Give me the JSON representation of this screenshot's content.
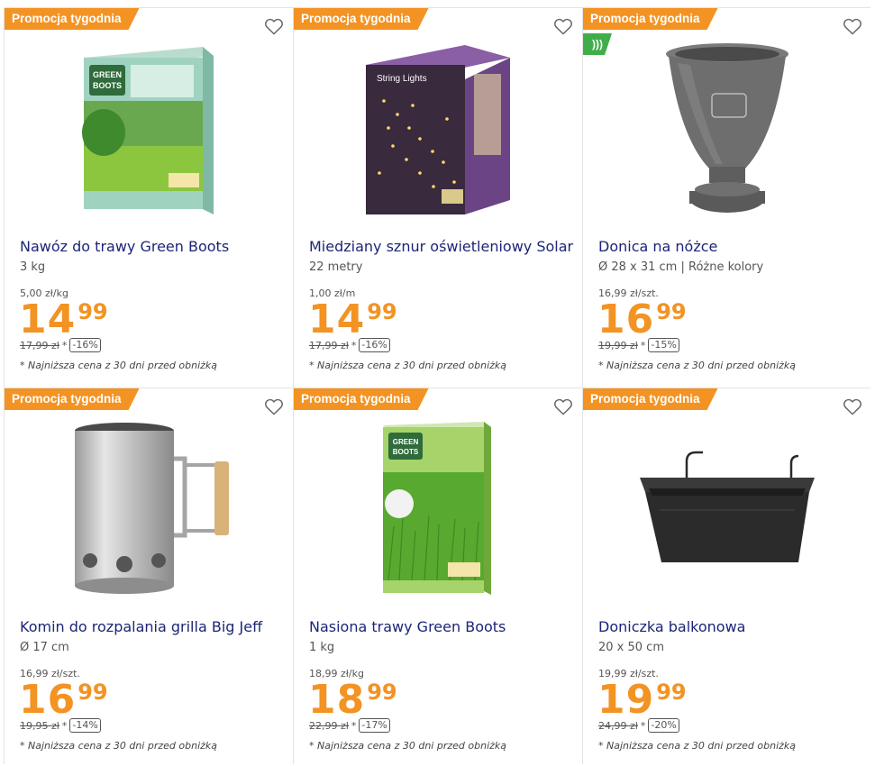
{
  "colors": {
    "badge": "#f39323",
    "price": "#f39323",
    "title": "#1c2578",
    "eco": "#3fae49"
  },
  "products": [
    {
      "badge": "Promocja tygodnia",
      "name": "Nawóz do trawy Green Boots",
      "variant": "3 kg",
      "unit_price": "5,00 zł/kg",
      "price_int": "14",
      "price_dec": "99",
      "old_price": "17,99 zł",
      "old_star": "*",
      "discount": "-16%",
      "note": "* Najniższa cena z 30 dni przed obniżką",
      "image_icon": "green-boots-fertilizer-box"
    },
    {
      "badge": "Promocja tygodnia",
      "name": "Miedziany sznur oświetleniowy Solar",
      "variant": "22 metry",
      "unit_price": "1,00 zł/m",
      "price_int": "14",
      "price_dec": "99",
      "old_price": "17,99 zł",
      "old_star": "*",
      "discount": "-16%",
      "note": "* Najniższa cena z 30 dni przed obniżką",
      "image_icon": "solar-string-lights-box"
    },
    {
      "badge": "Promocja tygodnia",
      "eco_icon": "eco-leaf-icon",
      "name": "Donica na nóżce",
      "variant": "Ø 28 x 31 cm | Różne kolory",
      "unit_price": "16,99 zł/szt.",
      "price_int": "16",
      "price_dec": "99",
      "old_price": "19,99 zł",
      "old_star": "*",
      "discount": "-15%",
      "note": "* Najniższa cena z 30 dni przed obniżką",
      "image_icon": "footed-planter"
    },
    {
      "badge": "Promocja tygodnia",
      "name": "Komin do rozpalania grilla Big Jeff",
      "variant": "Ø 17 cm",
      "unit_price": "16,99 zł/szt.",
      "price_int": "16",
      "price_dec": "99",
      "old_price": "19,95 zł",
      "old_star": "*",
      "discount": "-14%",
      "note": "* Najniższa cena z 30 dni przed obniżką",
      "image_icon": "chimney-starter"
    },
    {
      "badge": "Promocja tygodnia",
      "name": "Nasiona trawy Green Boots",
      "variant": "1 kg",
      "unit_price": "18,99 zł/kg",
      "price_int": "18",
      "price_dec": "99",
      "old_price": "22,99 zł",
      "old_star": "*",
      "discount": "-17%",
      "note": "* Najniższa cena z 30 dni przed obniżką",
      "image_icon": "grass-seeds-box"
    },
    {
      "badge": "Promocja tygodnia",
      "name": "Doniczka balkonowa",
      "variant": "20 x 50 cm",
      "unit_price": "19,99 zł/szt.",
      "price_int": "19",
      "price_dec": "99",
      "old_price": "24,99 zł",
      "old_star": "*",
      "discount": "-20%",
      "note": "* Najniższa cena z 30 dni przed obniżką",
      "image_icon": "balcony-planter"
    }
  ]
}
